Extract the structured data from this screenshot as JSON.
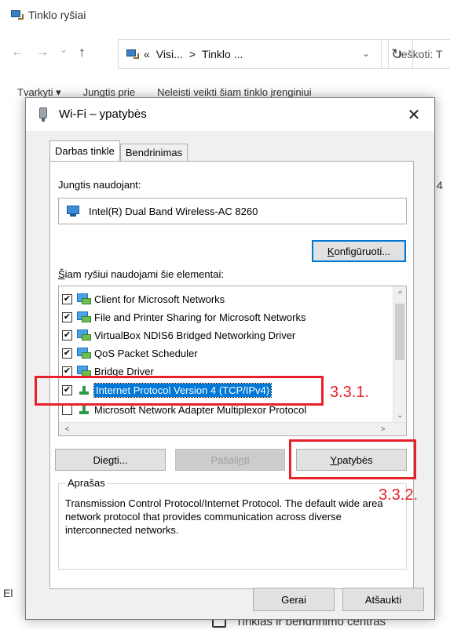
{
  "explorer": {
    "title": "Tinklo ryšiai",
    "nav": {
      "back": "←",
      "forward": "→",
      "recent": "⌄",
      "up": "↑"
    },
    "address": {
      "prefix": "«",
      "crumb1": "Visi...",
      "sep": ">",
      "crumb2": "Tinklo ...",
      "dropdown": "⌄"
    },
    "refresh": "↻",
    "search_placeholder": "Ieškoti: T",
    "commands": [
      "Tvarkyti ▾",
      "Jungtis prie",
      "Neleisti veikti šiam tinklo įrenginiui"
    ],
    "side_number": "4",
    "side_letters": "El",
    "bottom_link": "Tinklas ir bendrinimo centras"
  },
  "dialog": {
    "title": "Wi-Fi – ypatybės",
    "close": "✕",
    "tabs": [
      {
        "label": "Darbas tinkle",
        "active": true
      },
      {
        "label": "Bendrinimas",
        "active": false
      }
    ],
    "connect_using_label": "Jungtis naudojant:",
    "adapter_name": "Intel(R) Dual Band Wireless-AC 8260",
    "configure_prefix": "",
    "configure_underlined": "K",
    "configure_rest": "onfigūruoti...",
    "components_label_underlined": "Š",
    "components_label_rest": "iam ryšiui naudojami šie elementai:",
    "items": [
      {
        "label": "Client for Microsoft Networks",
        "checked": true,
        "icon": "network-client-icon"
      },
      {
        "label": "File and Printer Sharing for Microsoft Networks",
        "checked": true,
        "icon": "network-service-icon"
      },
      {
        "label": "VirtualBox NDIS6 Bridged Networking Driver",
        "checked": true,
        "icon": "network-service-icon"
      },
      {
        "label": "QoS Packet Scheduler",
        "checked": true,
        "icon": "network-service-icon"
      },
      {
        "label": "Bridge Driver",
        "checked": true,
        "icon": "network-service-icon"
      },
      {
        "label": "Internet Protocol Version 4 (TCP/IPv4)",
        "checked": true,
        "icon": "protocol-icon",
        "selected": true
      },
      {
        "label": "Microsoft Network Adapter Multiplexor Protocol",
        "checked": false,
        "icon": "protocol-icon"
      }
    ],
    "checkmark": "✔",
    "scroll_up": "^",
    "scroll_down": "⌄",
    "scroll_left": "<",
    "scroll_right": ">",
    "install_prefix": "Die",
    "install_underlined": "g",
    "install_rest": "ti...",
    "uninstall_prefix": "Pašali",
    "uninstall_underlined": "n",
    "uninstall_rest": "ti",
    "properties_underlined": "Y",
    "properties_rest": "patybės",
    "description_legend": "Aprašas",
    "description_text": "Transmission Control Protocol/Internet Protocol. The default wide area network protocol that provides communication across diverse interconnected networks.",
    "ok_label": "Gerai",
    "cancel_label": "Atšaukti"
  },
  "annotations": {
    "label_1": "3.3.1.",
    "label_2": "3.3.2.",
    "color": "#e8202a"
  }
}
